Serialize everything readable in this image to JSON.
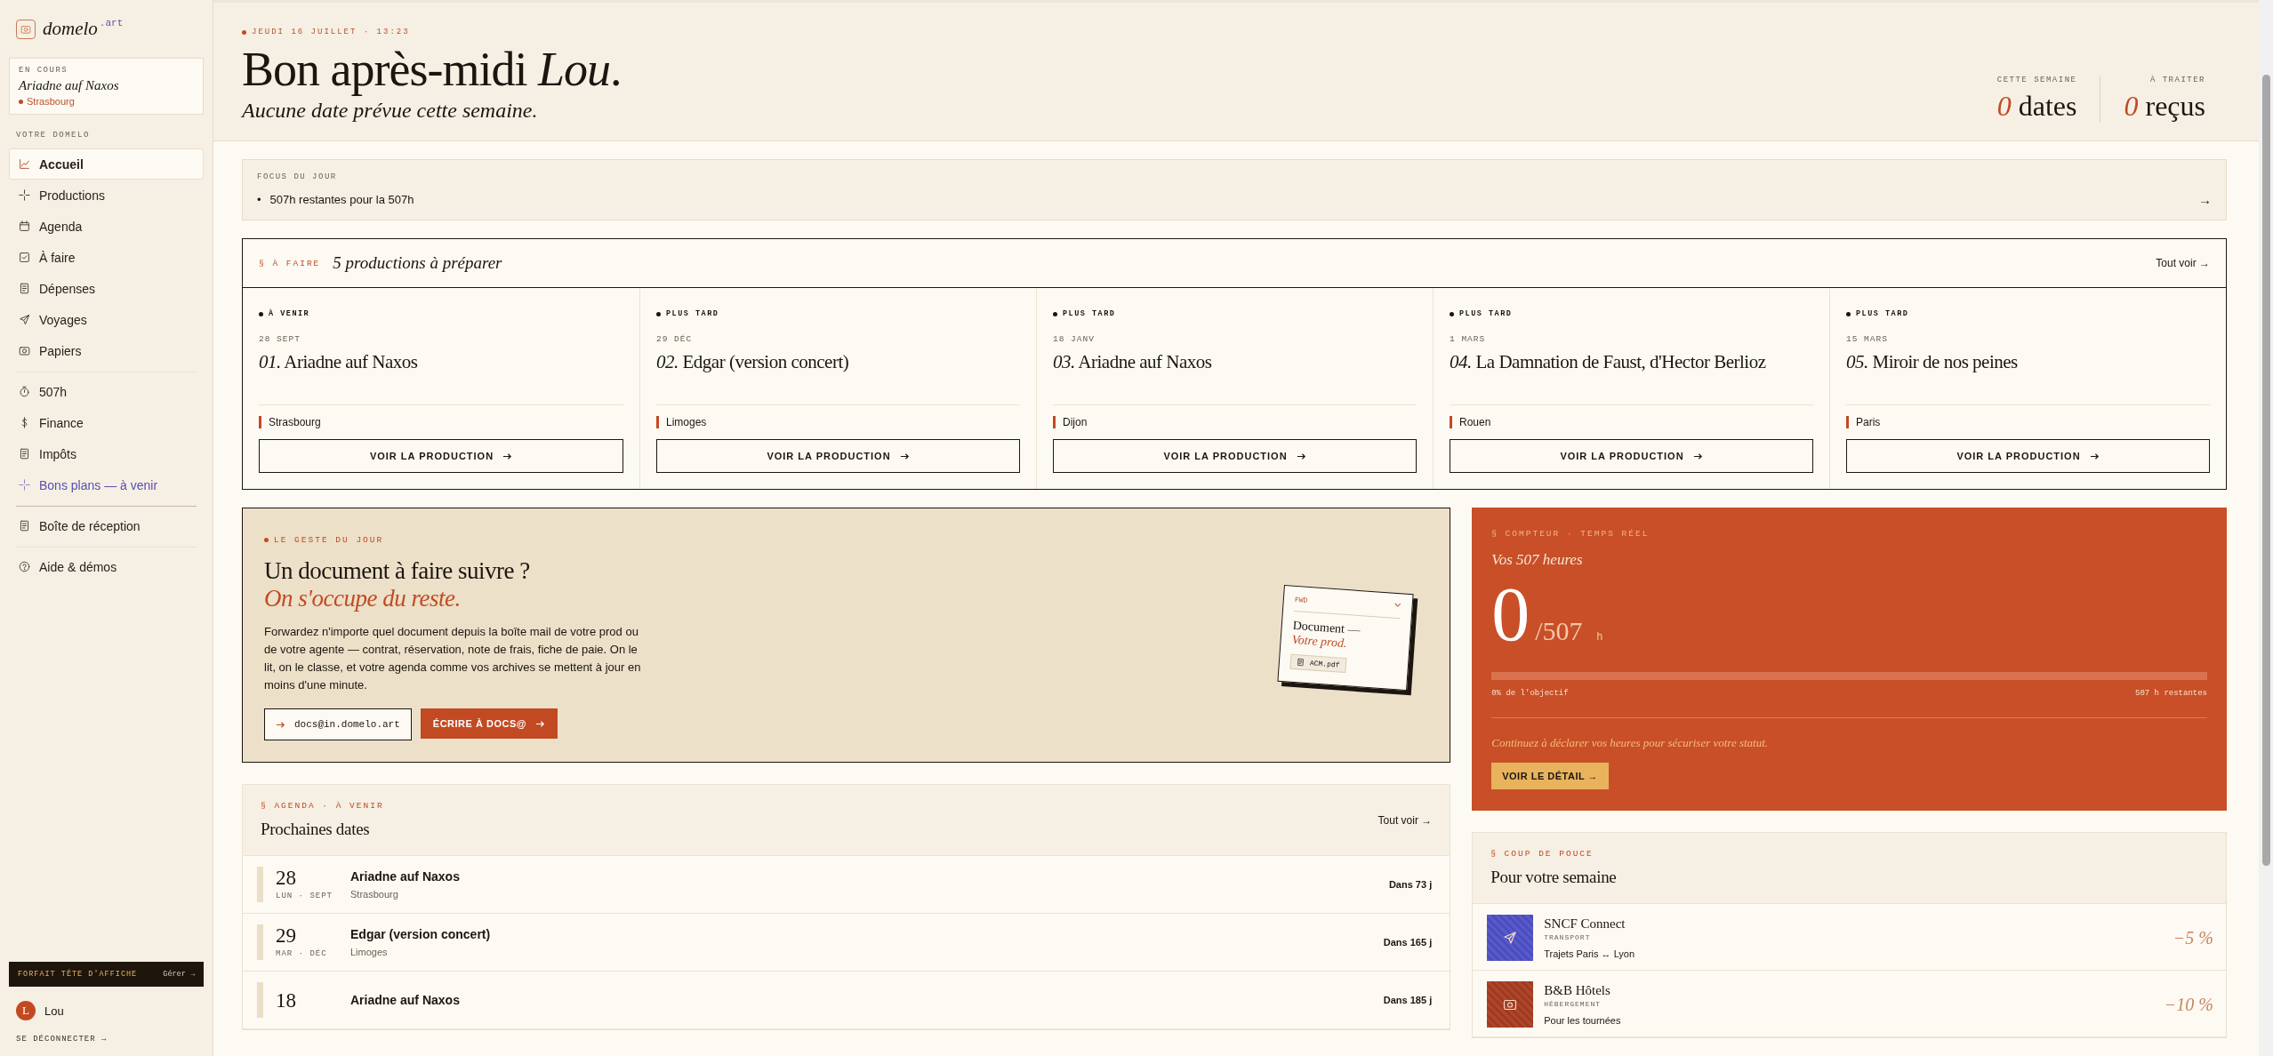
{
  "sidebar": {
    "brand": "domelo",
    "brand_suffix": ".art",
    "current": {
      "label": "EN COURS",
      "title": "Ariadne auf Naxos",
      "city": "Strasbourg"
    },
    "nav_heading": "VOTRE DOMELO",
    "nav_groups": [
      [
        {
          "label": "Accueil",
          "selected": true,
          "kind": "normal"
        },
        {
          "label": "Productions",
          "selected": false,
          "kind": "normal"
        },
        {
          "label": "Agenda",
          "selected": false,
          "kind": "normal"
        },
        {
          "label": "À faire",
          "selected": false,
          "kind": "normal"
        },
        {
          "label": "Dépenses",
          "selected": false,
          "kind": "normal"
        },
        {
          "label": "Voyages",
          "selected": false,
          "kind": "normal"
        },
        {
          "label": "Papiers",
          "selected": false,
          "kind": "normal"
        }
      ],
      [
        {
          "label": "507h",
          "selected": false,
          "kind": "normal"
        },
        {
          "label": "Finance",
          "selected": false,
          "kind": "normal"
        },
        {
          "label": "Impôts",
          "selected": false,
          "kind": "normal"
        },
        {
          "label": "Bons plans — à venir",
          "selected": false,
          "kind": "upcoming"
        }
      ],
      [
        {
          "label": "Boîte de réception",
          "selected": false,
          "kind": "normal"
        }
      ],
      [
        {
          "label": "Aide & démos",
          "selected": false,
          "kind": "normal"
        }
      ]
    ],
    "plan": {
      "label": "FORFAIT TÊTE D'AFFICHE",
      "action": "Gérer →"
    },
    "user": {
      "initial": "L",
      "name": "Lou"
    },
    "logout": "SE DÉCONNECTER →"
  },
  "header": {
    "date": "JEUDI 16 JUILLET · 13:23",
    "greeting": "Bon après-midi *Lou*.",
    "subtitle": "Aucune date prévue cette semaine.",
    "stats": [
      {
        "label": "CETTE SEMAINE",
        "value": "0",
        "unit": "dates"
      },
      {
        "label": "À TRAITER",
        "value": "0",
        "unit": "reçus"
      }
    ]
  },
  "focus": {
    "label": "FOCUS DU JOUR",
    "bullet": "•",
    "items": [
      "507h restantes pour la 507h"
    ],
    "arrow": "→"
  },
  "todo": {
    "section": "§ À FAIRE",
    "title": "5 productions à préparer",
    "link": "Tout voir →",
    "cards": [
      {
        "status": "À VENIR",
        "date": "28 SEPT",
        "number": "01.",
        "title": "Ariadne auf Naxos",
        "city": "Strasbourg",
        "button": "VOIR LA PRODUCTION"
      },
      {
        "status": "PLUS TARD",
        "date": "29 DÉC",
        "number": "02.",
        "title": "Edgar (version concert)",
        "city": "Limoges",
        "button": "VOIR LA PRODUCTION"
      },
      {
        "status": "PLUS TARD",
        "date": "18 JANV",
        "number": "03.",
        "title": "Ariadne auf Naxos",
        "city": "Dijon",
        "button": "VOIR LA PRODUCTION"
      },
      {
        "status": "PLUS TARD",
        "date": "1 MARS",
        "number": "04.",
        "title": "La Damnation de Faust, d'Hector Berlioz",
        "city": "Rouen",
        "button": "VOIR LA PRODUCTION"
      },
      {
        "status": "PLUS TARD",
        "date": "15 MARS",
        "number": "05.",
        "title": "Miroir de nos peines",
        "city": "Paris",
        "button": "VOIR LA PRODUCTION"
      }
    ]
  },
  "geste": {
    "label": "LE GESTE DU JOUR",
    "title": "Un document à faire suivre ?",
    "title_accent": "On s'occupe du reste.",
    "body": "Forwardez n'importe quel document depuis la boîte mail de votre prod ou de votre agente — contrat, réservation, note de frais, fiche de paie. On le lit, on le classe, et votre agenda comme vos archives se mettent à jour en moins d'une minute.",
    "email": "docs@in.domelo.art",
    "button": "ÉCRIRE À DOCS@",
    "illustration": {
      "tag": "FWD",
      "title": "Document —",
      "subtitle": "Votre prod.",
      "file": "ACM.pdf"
    }
  },
  "counter": {
    "label": "§ COMPTEUR · TEMPS RÉEL",
    "title": "Vos 507 heures",
    "value": "0",
    "total": "/507",
    "unit": "h",
    "level": 0,
    "progress_label": "0% de l'objectif",
    "remaining": "507 h restantes",
    "note": "Continuez à déclarer vos heures pour sécuriser votre statut.",
    "button": "VOIR LE DÉTAIL →"
  },
  "agenda": {
    "label": "§ AGENDA · À VENIR",
    "title": "Prochaines dates",
    "link": "Tout voir →",
    "rows": [
      {
        "day": "28",
        "sub": "LUN · SEPT",
        "title": "Ariadne auf Naxos",
        "city": "Strasbourg",
        "countdown": "Dans 73 j"
      },
      {
        "day": "29",
        "sub": "MAR · DÉC",
        "title": "Edgar (version concert)",
        "city": "Limoges",
        "countdown": "Dans 165 j"
      },
      {
        "day": "18",
        "title": "Ariadne auf Naxos",
        "countdown": "Dans 185 j"
      }
    ]
  },
  "deals": {
    "label": "§ COUP DE POUCE",
    "title": "Pour votre semaine",
    "items": [
      {
        "name": "SNCF Connect",
        "category": "TRANSPORT",
        "desc": "Trajets Paris ↔ Lyon",
        "discount": "−5 %",
        "color": "#4a4cc2"
      },
      {
        "name": "B&B Hôtels",
        "category": "HÉBERGEMENT",
        "desc": "Pour les tournées",
        "discount": "−10 %",
        "color": "#a3381d"
      }
    ]
  }
}
